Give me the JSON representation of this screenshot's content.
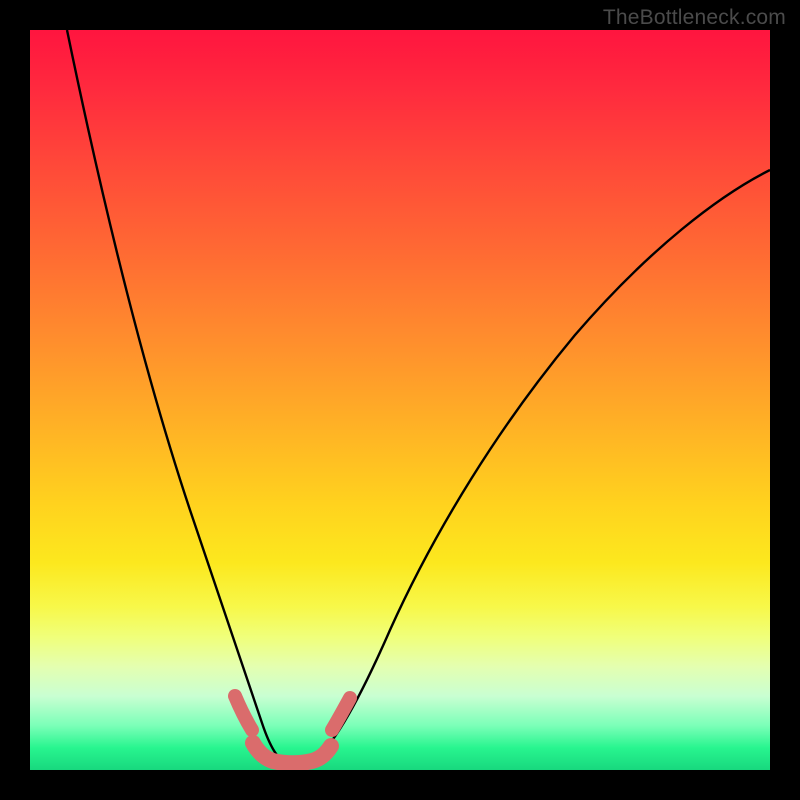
{
  "watermark": "TheBottleneck.com",
  "chart_data": {
    "type": "line",
    "title": "",
    "xlabel": "",
    "ylabel": "",
    "xlim": [
      0,
      100
    ],
    "ylim": [
      0,
      100
    ],
    "grid": false,
    "background_gradient": {
      "top_color": "#ff153f",
      "mid_color": "#ffd21e",
      "bottom_color": "#18d87e"
    },
    "series": [
      {
        "name": "left-branch",
        "color": "#000000",
        "x": [
          5,
          10,
          15,
          20,
          23,
          26,
          28,
          30,
          32
        ],
        "y": [
          100,
          80,
          60,
          40,
          27,
          15,
          8,
          3,
          1
        ]
      },
      {
        "name": "right-branch",
        "color": "#000000",
        "x": [
          38,
          41,
          45,
          50,
          58,
          68,
          80,
          92,
          100
        ],
        "y": [
          2,
          5,
          12,
          22,
          38,
          54,
          67,
          76,
          81
        ]
      },
      {
        "name": "valley-floor",
        "color": "#da6c6c",
        "x": [
          30,
          32,
          35,
          38,
          40
        ],
        "y": [
          2,
          1,
          1,
          1,
          2
        ]
      },
      {
        "name": "left-marker-cluster",
        "color": "#da6c6c",
        "x": [
          27.5,
          28.5
        ],
        "y": [
          9,
          6
        ]
      },
      {
        "name": "right-marker-cluster",
        "color": "#da6c6c",
        "x": [
          40.5,
          42
        ],
        "y": [
          5,
          8
        ]
      }
    ]
  }
}
